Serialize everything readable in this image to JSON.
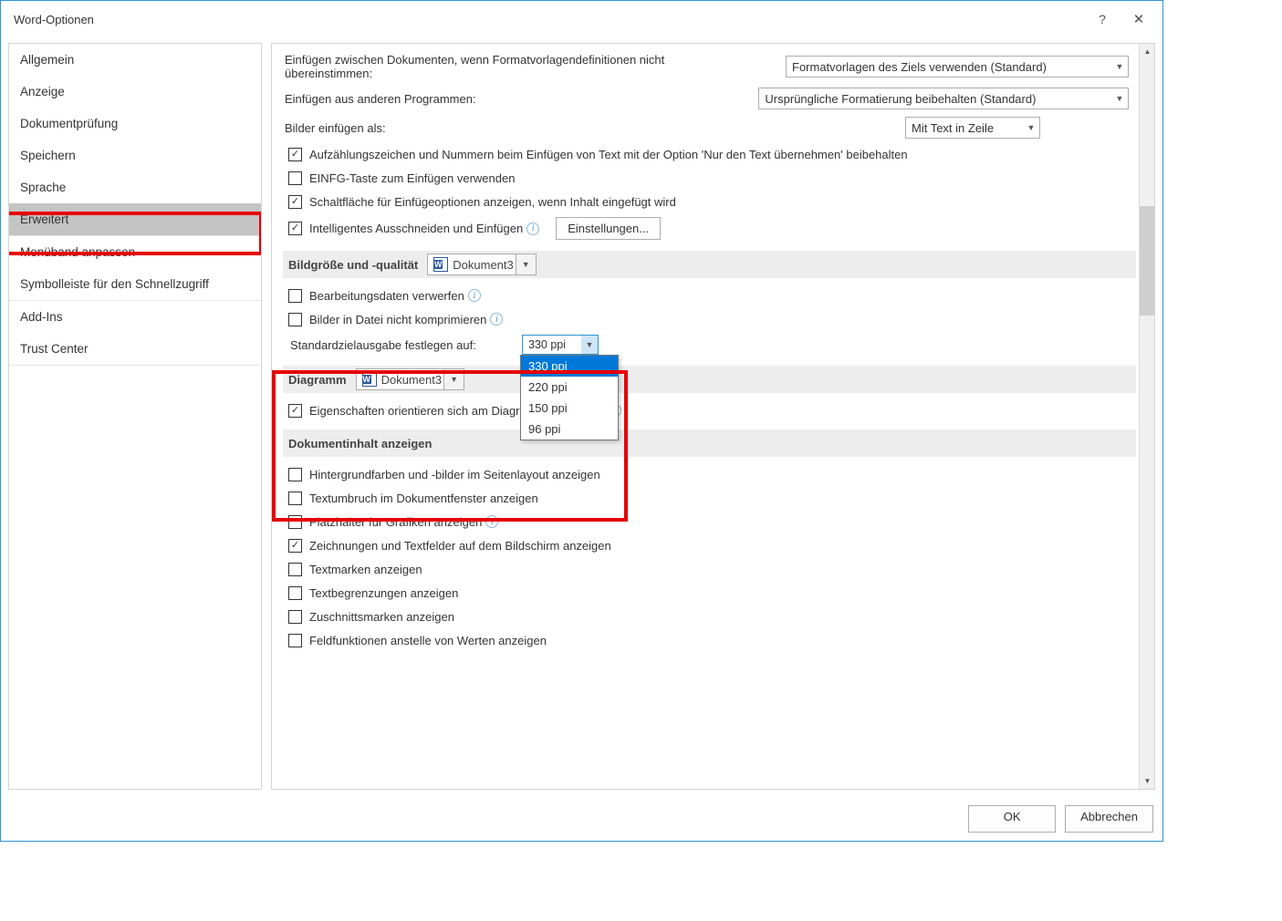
{
  "window": {
    "title": "Word-Optionen"
  },
  "sidebar": {
    "items": [
      {
        "label": "Allgemein"
      },
      {
        "label": "Anzeige"
      },
      {
        "label": "Dokumentprüfung"
      },
      {
        "label": "Speichern"
      },
      {
        "label": "Sprache"
      },
      {
        "label": "Erweitert"
      },
      {
        "label": "Menüband anpassen"
      },
      {
        "label": "Symbolleiste für den Schnellzugriff"
      },
      {
        "label": "Add-Ins"
      },
      {
        "label": "Trust Center"
      }
    ]
  },
  "paste": {
    "between_docs_label_1": "Einfügen zwischen Dokumenten, wenn Formatvorlagendefinitionen nicht",
    "between_docs_label_2": "übereinstimmen:",
    "between_docs_value": "Formatvorlagen des Ziels verwenden (Standard)",
    "other_programs_label": "Einfügen aus anderen Programmen:",
    "other_programs_value": "Ursprüngliche Formatierung beibehalten (Standard)",
    "insert_images_label": "Bilder einfügen als:",
    "insert_images_value": "Mit Text in Zeile",
    "keep_bullets_label": "Aufzählungszeichen und Nummern beim Einfügen von Text mit der Option 'Nur den Text übernehmen' beibehalten",
    "insert_key_label": "EINFG-Taste zum Einfügen verwenden",
    "show_paste_btn_label": "Schaltfläche für Einfügeoptionen anzeigen, wenn Inhalt eingefügt wird",
    "smart_cut_label": "Intelligentes Ausschneiden und Einfügen",
    "settings_btn": "Einstellungen..."
  },
  "image": {
    "section_title": "Bildgröße und -qualität",
    "doc_value": "Dokument3",
    "discard_edit_label": "Bearbeitungsdaten verwerfen",
    "no_compress_label": "Bilder in Datei nicht komprimieren",
    "default_res_label": "Standardzielausgabe festlegen auf:",
    "default_res_value": "330 ppi",
    "res_options": [
      "330 ppi",
      "220 ppi",
      "150 ppi",
      "96 ppi"
    ]
  },
  "chart": {
    "section_title": "Diagramm",
    "doc_value": "Dokument3",
    "props_follow_label": "Eigenschaften orientieren sich am Diagrammdatenpunkt"
  },
  "docview": {
    "section_title": "Dokumentinhalt anzeigen",
    "bg_colors_label": "Hintergrundfarben und -bilder im Seitenlayout anzeigen",
    "text_wrap_label": "Textumbruch im Dokumentfenster anzeigen",
    "placeholders_label": "Platzhalter für Grafiken anzeigen",
    "drawings_label": "Zeichnungen und Textfelder auf dem Bildschirm anzeigen",
    "bookmarks_label": "Textmarken anzeigen",
    "text_bounds_label": "Textbegrenzungen anzeigen",
    "crop_marks_label": "Zuschnittsmarken anzeigen",
    "field_codes_label": "Feldfunktionen anstelle von Werten anzeigen"
  },
  "footer": {
    "ok": "OK",
    "cancel": "Abbrechen"
  }
}
